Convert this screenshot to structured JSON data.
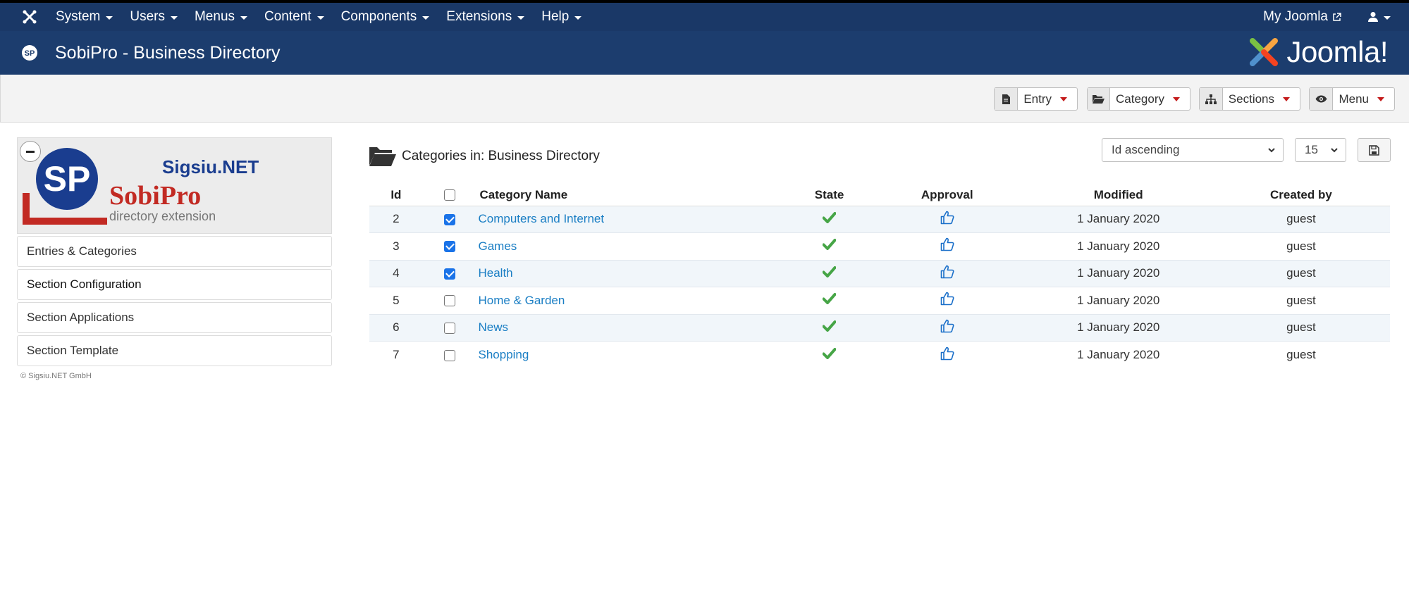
{
  "topnav": {
    "menu": [
      {
        "label": "System"
      },
      {
        "label": "Users"
      },
      {
        "label": "Menus"
      },
      {
        "label": "Content"
      },
      {
        "label": "Components"
      },
      {
        "label": "Extensions"
      },
      {
        "label": "Help"
      }
    ],
    "my_joomla": "My Joomla"
  },
  "header": {
    "title": "SobiPro - Business Directory",
    "brand": "Joomla!"
  },
  "toolbar": {
    "buttons": [
      {
        "label": "Entry",
        "icon": "file-icon"
      },
      {
        "label": "Category",
        "icon": "folder-open-icon"
      },
      {
        "label": "Sections",
        "icon": "sitemap-icon"
      },
      {
        "label": "Menu",
        "icon": "eye-icon"
      }
    ]
  },
  "sidebar": {
    "logo_text_top": "Sigsiu.NET",
    "logo_text_main": "SobiPro",
    "logo_text_sub": "directory extension",
    "items": [
      {
        "label": "Entries & Categories"
      },
      {
        "label": "Section Configuration"
      },
      {
        "label": "Section Applications"
      },
      {
        "label": "Section Template"
      }
    ],
    "copyright": "© Sigsiu.NET GmbH"
  },
  "main": {
    "title": "Categories in: Business Directory",
    "sort_value": "Id ascending",
    "limit_value": "15",
    "columns": {
      "id": "Id",
      "name": "Category Name",
      "state": "State",
      "approval": "Approval",
      "modified": "Modified",
      "created_by": "Created by"
    },
    "rows": [
      {
        "id": "2",
        "name": "Computers and Internet",
        "checked": true,
        "modified": "1 January 2020",
        "created_by": "guest"
      },
      {
        "id": "3",
        "name": "Games",
        "checked": true,
        "modified": "1 January 2020",
        "created_by": "guest"
      },
      {
        "id": "4",
        "name": "Health",
        "checked": true,
        "modified": "1 January 2020",
        "created_by": "guest"
      },
      {
        "id": "5",
        "name": "Home & Garden",
        "checked": false,
        "modified": "1 January 2020",
        "created_by": "guest"
      },
      {
        "id": "6",
        "name": "News",
        "checked": false,
        "modified": "1 January 2020",
        "created_by": "guest"
      },
      {
        "id": "7",
        "name": "Shopping",
        "checked": false,
        "modified": "1 January 2020",
        "created_by": "guest"
      }
    ]
  },
  "colors": {
    "topnav_bg": "#1a3867",
    "header_bg": "#1c3d6e",
    "link": "#1a7ec4",
    "state_ok": "#46a546",
    "approval": "#1a6fc9",
    "caret": "#c41b1b"
  }
}
